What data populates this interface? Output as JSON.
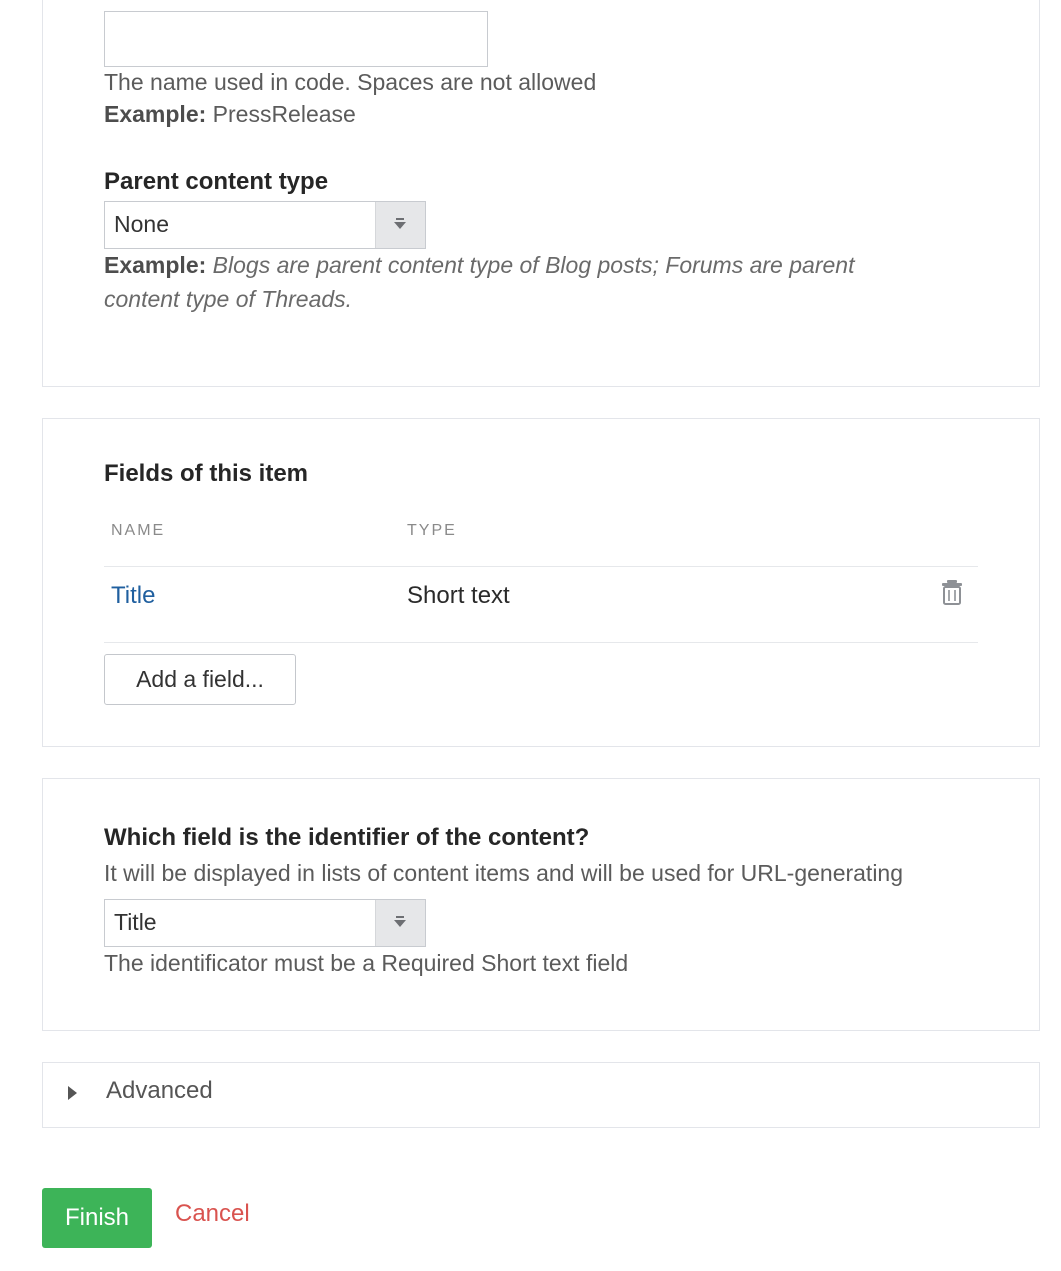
{
  "name_section": {
    "technical_name_value": "",
    "help_line": "The name used in code. Spaces are not allowed",
    "example_label": "Example:",
    "example_value": "PressRelease"
  },
  "parent_section": {
    "label": "Parent content type",
    "selected": "None",
    "example_label": "Example:",
    "example_line1": "Blogs are parent content type of Blog posts; Forums are parent",
    "example_line2": "content type of Threads."
  },
  "fields_section": {
    "heading": "Fields of this item",
    "columns": [
      "NAME",
      "TYPE"
    ],
    "rows": [
      {
        "name": "Title",
        "type": "Short text",
        "action_icon": "trash-icon"
      }
    ],
    "add_button": "Add a field..."
  },
  "identifier_section": {
    "heading": "Which field is the identifier of the content?",
    "description": "It will be displayed in lists of content items and will be used for URL-generating",
    "selected": "Title",
    "note": "The identificator must be a Required Short text field"
  },
  "advanced": {
    "label": "Advanced",
    "expanded": false
  },
  "actions": {
    "finish": "Finish",
    "cancel": "Cancel"
  },
  "colors": {
    "link": "#1f5f9f",
    "finish_bg": "#3db458",
    "cancel": "#d9534f",
    "border": "#e3e5ea"
  }
}
